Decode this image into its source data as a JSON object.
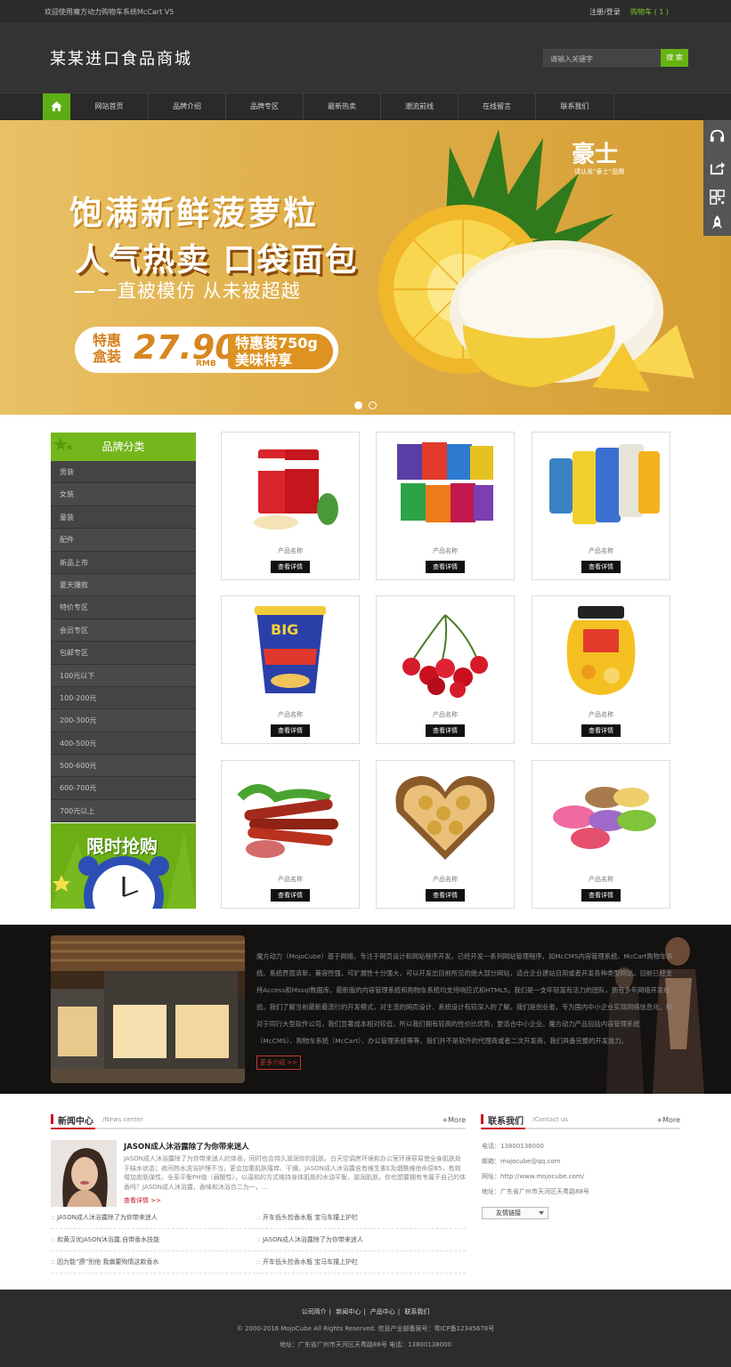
{
  "topbar": {
    "welcome": "欢迎使用魔方动力购物车系统McCart V5",
    "login": "注册/登录",
    "cart": "购物车 ( 1 )"
  },
  "header": {
    "logo": "某某进口食品商城",
    "search_placeholder": "请输入关键字",
    "search_button": "搜 索"
  },
  "nav": {
    "items": [
      "网站首页",
      "品牌介绍",
      "品牌专区",
      "最新热卖",
      "潮流前线",
      "在线留言",
      "联系我们"
    ]
  },
  "banner": {
    "line1": "饱满新鲜菠萝粒",
    "line2": "人气热卖 口袋面包",
    "line3": "一直被模仿 从未被超越",
    "special": "特惠盒装",
    "price": "27.90",
    "currency": "RMB",
    "right_line1": "特惠装750g",
    "right_line2": "美味特享",
    "brand": "豪士",
    "brand_sub": "请认准“豪士”品牌",
    "slides": 2,
    "active_slide": 1
  },
  "categories": {
    "title": "品牌分类",
    "items": [
      "男装",
      "女装",
      "童装",
      "配件",
      "新品上市",
      "夏天爆款",
      "特价专区",
      "会员专区",
      "包邮专区",
      "100元以下",
      "100-200元",
      "200-300元",
      "400-500元",
      "500-600元",
      "600-700元",
      "700元以上"
    ],
    "promo": "限时抢购"
  },
  "products": [
    {
      "name": "产品名称",
      "button": "查看详情",
      "icon": "snack-can-icon"
    },
    {
      "name": "产品名称",
      "button": "查看详情",
      "icon": "chips-bags-icon"
    },
    {
      "name": "产品名称",
      "button": "查看详情",
      "icon": "soda-cans-icon"
    },
    {
      "name": "产品名称",
      "button": "查看详情",
      "icon": "instant-noodle-icon"
    },
    {
      "name": "产品名称",
      "button": "查看详情",
      "icon": "cherries-icon"
    },
    {
      "name": "产品名称",
      "button": "查看详情",
      "icon": "fruit-jar-icon"
    },
    {
      "name": "产品名称",
      "button": "查看详情",
      "icon": "sausages-icon"
    },
    {
      "name": "产品名称",
      "button": "查看详情",
      "icon": "chocolate-box-icon"
    },
    {
      "name": "产品名称",
      "button": "查看详情",
      "icon": "macarons-icon"
    }
  ],
  "about": {
    "text": "魔方动力（MojoCube）基于网络，专注于网页设计和网站程序开发。已经开发一系列网站管理程序，如McCMS内容管理系统、McCart购物车系统。系统界面清新，兼容性强，可扩展性十分强大，可以开发出目前所见的绝大部分网站，适合企业建站自用或者开发各种类型网站。目前已经支持Access和Mssql数据库，最新版的内容管理系统和购物车系统均支持响应式和HTML5。我们是一支年轻富有活力的团队，拥有多年网络开发经验。我们了解当前最新最流行的开发模式，对主流的网页设计、系统设计有较深入的了解。我们是创业者，专为国内中小企业实现网络信息化。相对于同行大型软件公司，我们显著成本相对较低，所以我们拥有较高的性价比优势，更适合中小企业。魔方动力产品包括内容管理系统（McCMS）、购物车系统（McCart）、办公管理系统等等，我们并不是软件的代理商或者二次开发商，我们具备完整的开发能力。",
    "more": "更多介绍 >>"
  },
  "news": {
    "title": "新闻中心",
    "subtitle": "/News center",
    "more": "+More",
    "feature_title": "JASON成人沐浴露除了为你带来迷人",
    "feature_text": "JASON成人沐浴露除了为你带来迷人的体香，同时也会持久滋润你的肌肤。白天空调房环境和办公室环境容易使全身肌肤处于缺水状态；夜间热水洗浴护理不当，更会加重肌肤瘙痒、干燥。JASON成人沐浴露含有维生素E及烟酰维他命原B5，有效增加皮肤弹性。全系平衡PH值（弱酸性），以温和的方式维持身体肌肤的水油平衡，滋润肌肤。你也想要拥有专属于自己的体香吗？JASON成人沐浴露，香味和沐浴合二为一，...",
    "feature_more": "查看详情 >>",
    "items": [
      "JASON成人沐浴露除了为你带来迷人",
      "开车低头捡香水瓶 宝马车撞上护栏",
      "和黄汉优JASON沐浴露,自带香水技能",
      "JASON成人沐浴露除了为你带来迷人",
      "因为能“撩”别他 我偏要殉情这款香水",
      "开车低头捡香水瓶 宝马车撞上护栏"
    ]
  },
  "contact": {
    "title": "联系我们",
    "subtitle": "/Contact us",
    "more": "+More",
    "phone": "电话：13800138000",
    "email": "邮箱：mojocube@qq.com",
    "website": "网址：http://www.mojocube.com/",
    "address": "地址：广东省广州市天河区天粤路88号",
    "links": "友情链接"
  },
  "footer": {
    "links": [
      "公司简介",
      "新闻中心",
      "产品中心",
      "联系我们"
    ],
    "copyright": "© 2000-2016 MojoCube All Rights Reserved. 信息产业部备案号：粤ICP备12345678号",
    "address": "地址：广东省广州市天河区天粤路88号 电话：13800138000"
  },
  "colors": {
    "brand_green": "#66b311",
    "dark": "#2b2b2b",
    "accent_red": "#c9151e"
  }
}
